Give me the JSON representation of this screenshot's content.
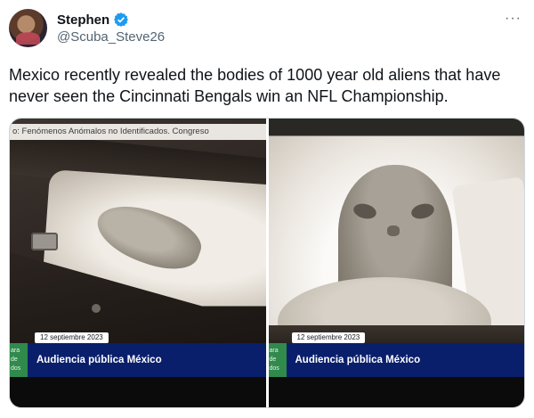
{
  "author": {
    "display_name": "Stephen",
    "handle": "@Scuba_Steve26",
    "verified": true,
    "verified_color": "#1d9bf0"
  },
  "menu": {
    "more_label": "···"
  },
  "tweet": {
    "text": "Mexico recently revealed the bodies of 1000 year old aliens that have never seen the Cincinnati Bengals win an NFL Championship."
  },
  "media": {
    "left": {
      "crawl_text": "o: Fenómenos Anómalos no Identificados. Congreso",
      "date": "12 septiembre 2023",
      "side_tag": [
        "ara",
        "de",
        "dos"
      ],
      "headline": "Audiencia pública México"
    },
    "right": {
      "date": "12 septiembre 2023",
      "side_tag": [
        "ara",
        "de",
        "dos"
      ],
      "headline": "Audiencia pública México"
    },
    "colors": {
      "lower_bar": "#0a1f6b",
      "side_tag": "#2f8a4c"
    }
  }
}
